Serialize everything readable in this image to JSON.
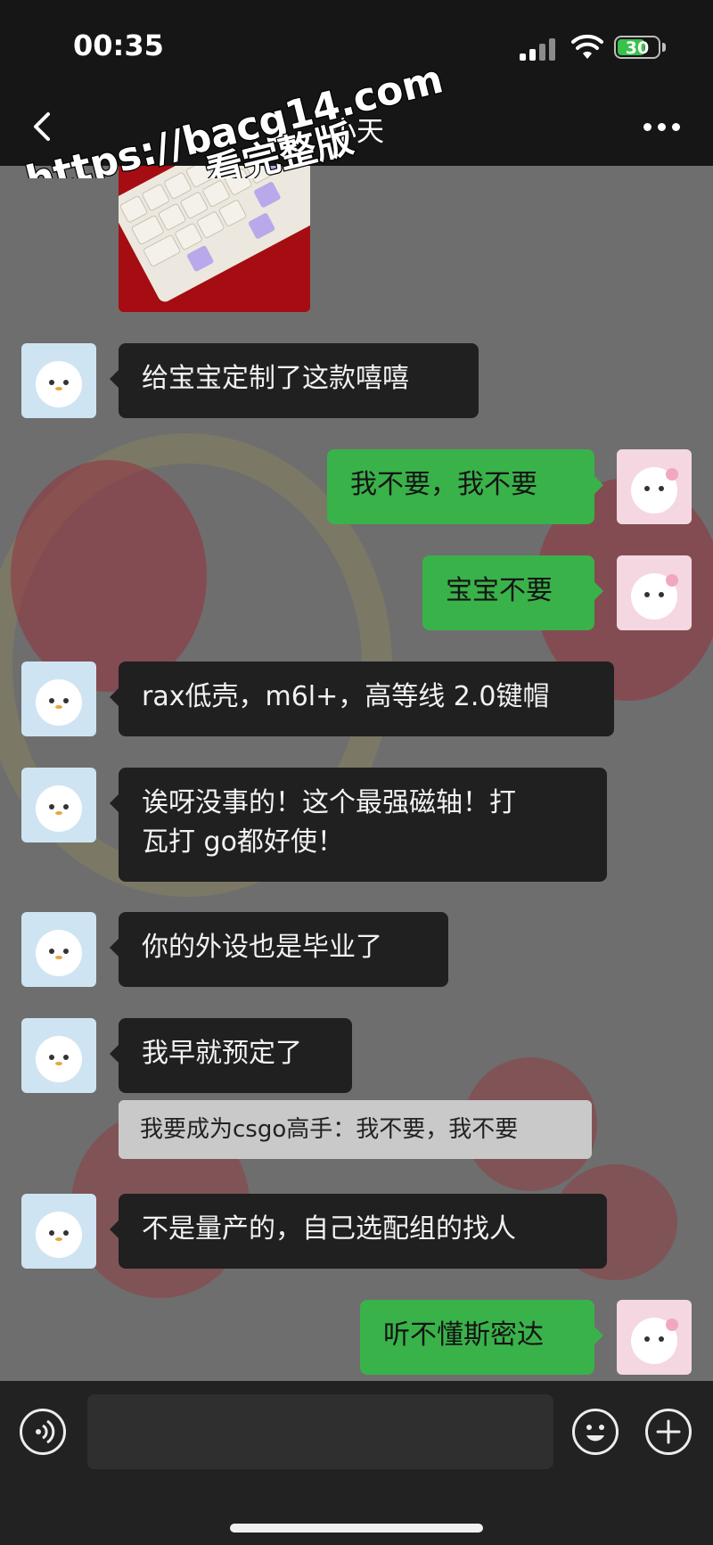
{
  "status_bar": {
    "time": "00:35",
    "battery": "30"
  },
  "header": {
    "title": "小天"
  },
  "watermark": {
    "line1": "https://bacg14.com",
    "line2": "看完整版"
  },
  "messages": [
    {
      "from": "them",
      "text": "给宝宝定制了这款嘻嘻"
    },
    {
      "from": "me",
      "text": "我不要，我不要"
    },
    {
      "from": "me",
      "text": "宝宝不要"
    },
    {
      "from": "them",
      "text": "rax低壳，m6l+，高等线 2.0键帽"
    },
    {
      "from": "them",
      "line1": "诶呀没事的！这个最强磁轴！打",
      "line2": "瓦打 go都好使！"
    },
    {
      "from": "them",
      "text": "你的外设也是毕业了"
    },
    {
      "from": "them",
      "text": "我早就预定了"
    },
    {
      "quote": "我要成为csgo高手：我不要，我不要"
    },
    {
      "from": "them",
      "text": "不是量产的，自己选配组的找人"
    },
    {
      "from": "me",
      "text": "听不懂斯密达"
    }
  ],
  "colors": {
    "sent_bubble": "#39b24a",
    "received_bubble": "#202020"
  }
}
